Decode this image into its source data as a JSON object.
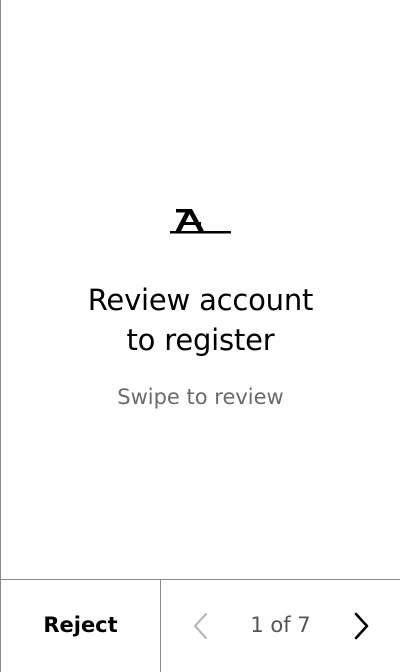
{
  "screen": {
    "logo_icon": "app-logo-icon",
    "title_line1": "Review account",
    "title_line2": "to register",
    "subtitle": "Swipe to review"
  },
  "footer": {
    "reject_label": "Reject",
    "pager": {
      "text": "1 of 7",
      "current": 1,
      "total": 7,
      "prev_icon": "chevron-left-icon",
      "next_icon": "chevron-right-icon"
    }
  },
  "colors": {
    "text": "#000000",
    "subtitle": "#6b6b6b",
    "pager_text": "#555555",
    "divider": "#8a8a8a",
    "disabled_chevron": "#b8b8b8",
    "background": "#ffffff"
  }
}
